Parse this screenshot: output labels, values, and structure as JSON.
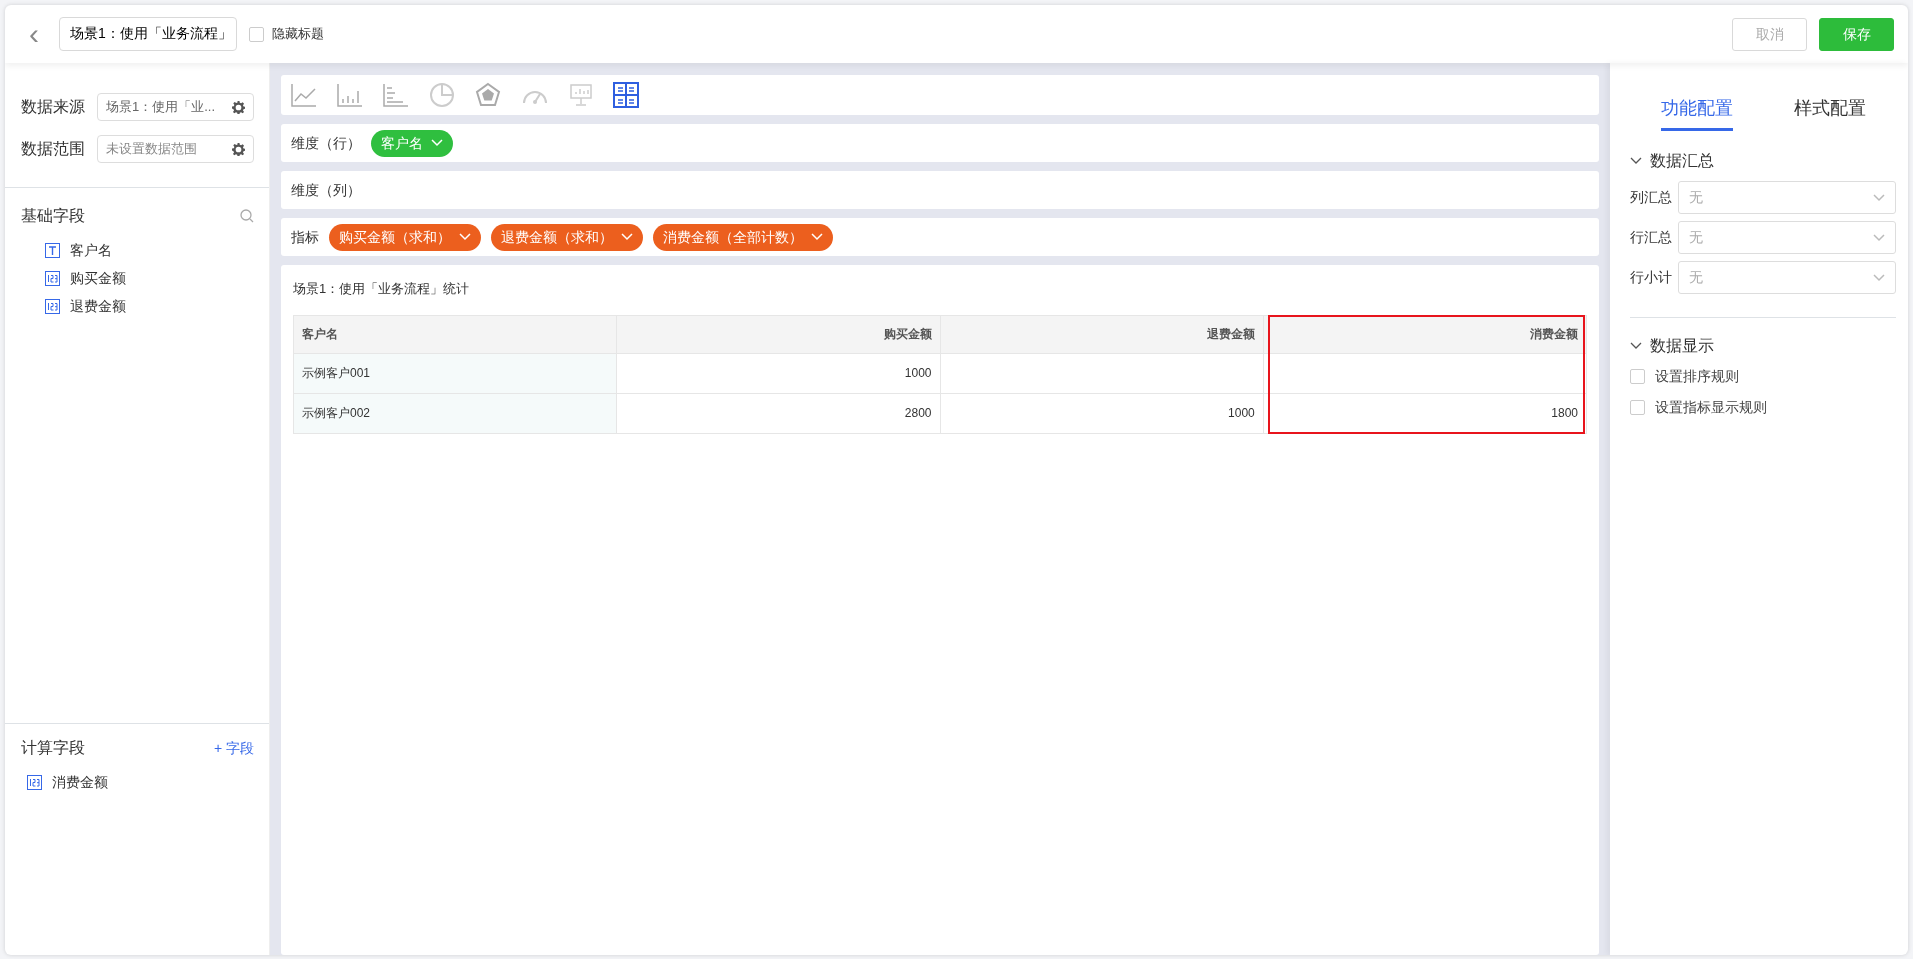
{
  "header": {
    "back": "‹",
    "title_value": "场景1：使用「业务流程」",
    "hide_title": {
      "label": "隐藏标题",
      "checked": false
    },
    "buttons": [
      {
        "label": "取消",
        "kind": "cancel"
      },
      {
        "label": "保存",
        "kind": "save"
      }
    ]
  },
  "left_panel": {
    "settings": [
      {
        "label": "数据来源",
        "value": "场景1：使用「业..."
      },
      {
        "label": "数据范围",
        "placeholder": "未设置数据范围"
      }
    ],
    "basic_fields": {
      "title": "基础字段",
      "items": [
        {
          "name": "客户名",
          "kind": "text"
        },
        {
          "name": "购买金额",
          "kind": "number"
        },
        {
          "name": "退费金额",
          "kind": "number"
        }
      ]
    },
    "computed_fields": {
      "title": "计算字段",
      "add": "+ 字段",
      "items": [
        {
          "name": "消费金额",
          "kind": "number"
        }
      ]
    }
  },
  "chart_types": [
    {
      "kind": "line",
      "selected": false
    },
    {
      "kind": "bar",
      "selected": false
    },
    {
      "kind": "hbar",
      "selected": false
    },
    {
      "kind": "pie",
      "selected": false
    },
    {
      "kind": "radar",
      "selected": false
    },
    {
      "kind": "gauge",
      "selected": false
    },
    {
      "kind": "board",
      "selected": false
    },
    {
      "kind": "table",
      "selected": true
    }
  ],
  "shelves": [
    {
      "label": "维度（行）",
      "kind": "dimension",
      "tags": [
        "客户名"
      ]
    },
    {
      "label": "维度（列）"
    },
    {
      "label": "指标",
      "kind": "measure",
      "tags": [
        "购买金额（求和）",
        "退费金额（求和）",
        "消费金额（全部计数）"
      ]
    }
  ],
  "preview": {
    "title": "场景1：使用「业务流程」统计",
    "columns": [
      {
        "label": "客户名",
        "highlighted": false
      },
      {
        "label": "购买金额",
        "highlighted": false
      },
      {
        "label": "退费金额",
        "highlighted": false
      },
      {
        "label": "消费金额",
        "highlighted": true
      }
    ],
    "rows": [
      [
        "示例客户001",
        "1000",
        null,
        null
      ],
      [
        "示例客户002",
        "2800",
        "1000",
        "1800"
      ]
    ]
  },
  "right_panel": {
    "tabs": [
      {
        "label": "功能配置",
        "selected": true
      },
      {
        "label": "样式配置",
        "selected": false
      }
    ],
    "sections": [
      {
        "title": "数据汇总",
        "expanded": true,
        "selects": [
          {
            "label": "列汇总",
            "placeholder": "无"
          },
          {
            "label": "行汇总",
            "placeholder": "无"
          },
          {
            "label": "行小计",
            "placeholder": "无"
          }
        ]
      },
      {
        "title": "数据显示",
        "expanded": true,
        "checks": [
          {
            "label": "设置排序规则",
            "checked": false
          },
          {
            "label": "设置指标显示规则",
            "checked": false
          }
        ]
      }
    ]
  }
}
